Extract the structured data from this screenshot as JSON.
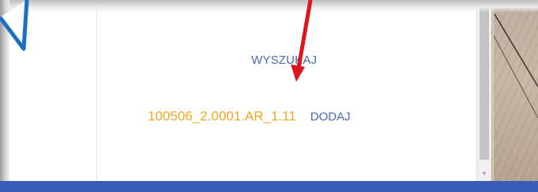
{
  "panel": {
    "search_label": "WYSZUKAJ",
    "results": [
      {
        "code": "100506_2.0001.AR_1.11",
        "action_label": "DODAJ"
      }
    ]
  },
  "icons": {
    "annotation_arrow": "red-arrow-icon",
    "callout_tail": "blue-callout-tail-icon",
    "scroll_down": "scroll-down-arrow-icon"
  },
  "colors": {
    "link": "#4b67b0",
    "code": "#f6a61f",
    "bottom_bar": "#3a5cb8",
    "arrow": "#e0141e",
    "callout": "#1a6fc4"
  }
}
